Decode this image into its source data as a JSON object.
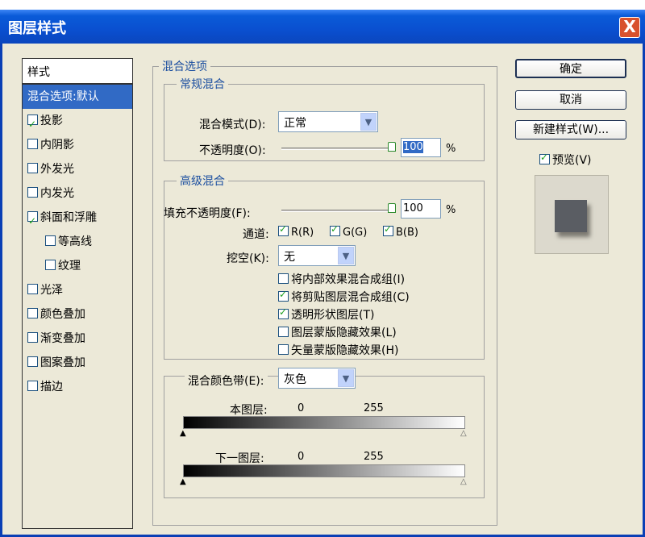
{
  "window": {
    "title": "图层样式",
    "close": "X"
  },
  "sidebar": {
    "header": "样式",
    "items": [
      {
        "label": "混合选项:默认",
        "checkbox": false,
        "checked": false,
        "selected": true,
        "indent": false
      },
      {
        "label": "投影",
        "checkbox": true,
        "checked": true,
        "selected": false,
        "indent": false
      },
      {
        "label": "内阴影",
        "checkbox": true,
        "checked": false,
        "selected": false,
        "indent": false
      },
      {
        "label": "外发光",
        "checkbox": true,
        "checked": false,
        "selected": false,
        "indent": false
      },
      {
        "label": "内发光",
        "checkbox": true,
        "checked": false,
        "selected": false,
        "indent": false
      },
      {
        "label": "斜面和浮雕",
        "checkbox": true,
        "checked": true,
        "selected": false,
        "indent": false
      },
      {
        "label": "等高线",
        "checkbox": true,
        "checked": false,
        "selected": false,
        "indent": true
      },
      {
        "label": "纹理",
        "checkbox": true,
        "checked": false,
        "selected": false,
        "indent": true
      },
      {
        "label": "光泽",
        "checkbox": true,
        "checked": false,
        "selected": false,
        "indent": false
      },
      {
        "label": "颜色叠加",
        "checkbox": true,
        "checked": false,
        "selected": false,
        "indent": false
      },
      {
        "label": "渐变叠加",
        "checkbox": true,
        "checked": false,
        "selected": false,
        "indent": false
      },
      {
        "label": "图案叠加",
        "checkbox": true,
        "checked": false,
        "selected": false,
        "indent": false
      },
      {
        "label": "描边",
        "checkbox": true,
        "checked": false,
        "selected": false,
        "indent": false
      }
    ]
  },
  "blend": {
    "group_title": "混合选项",
    "general": {
      "title": "常规混合",
      "mode_label": "混合模式(D):",
      "mode_value": "正常",
      "opacity_label": "不透明度(O):",
      "opacity_value": "100",
      "opacity_unit": "%"
    },
    "advanced": {
      "title": "高级混合",
      "fill_label": "填充不透明度(F):",
      "fill_value": "100",
      "fill_unit": "%",
      "channels_label": "通道:",
      "channel_r": "R(R)",
      "channel_g": "G(G)",
      "channel_b": "B(B)",
      "knockout_label": "挖空(K):",
      "knockout_value": "无",
      "options": [
        {
          "label": "将内部效果混合成组(I)",
          "checked": false
        },
        {
          "label": "将剪贴图层混合成组(C)",
          "checked": true
        },
        {
          "label": "透明形状图层(T)",
          "checked": true
        },
        {
          "label": "图层蒙版隐藏效果(L)",
          "checked": false
        },
        {
          "label": "矢量蒙版隐藏效果(H)",
          "checked": false
        }
      ]
    },
    "blend_if": {
      "label": "混合颜色带(E):",
      "value": "灰色",
      "this_layer_label": "本图层:",
      "this_layer_min": "0",
      "this_layer_max": "255",
      "under_layer_label": "下一图层:",
      "under_layer_min": "0",
      "under_layer_max": "255"
    }
  },
  "buttons": {
    "ok": "确定",
    "cancel": "取消",
    "new_style": "新建样式(W)...",
    "preview": "预览(V)"
  },
  "icons": {
    "dropdown": "chevron-down-icon",
    "close": "close-icon",
    "slider": "slider-thumb-icon"
  }
}
